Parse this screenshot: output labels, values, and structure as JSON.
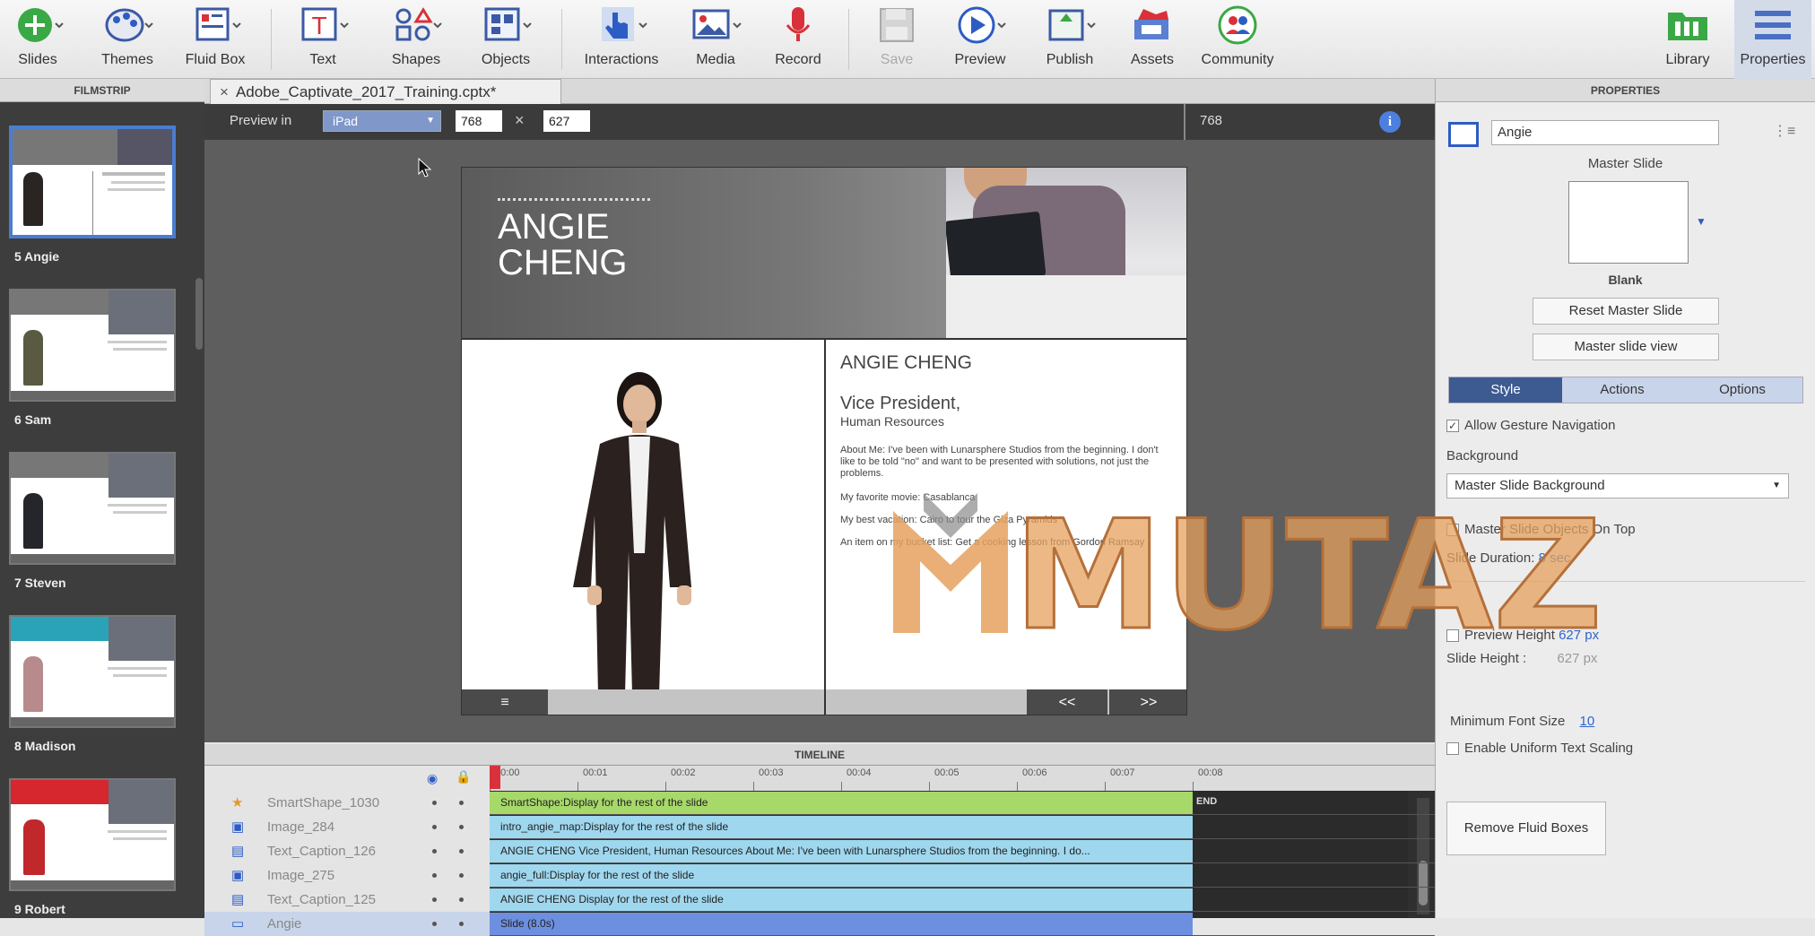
{
  "toolbar": {
    "items": [
      {
        "label": "Slides",
        "icon": "add-slide-icon"
      },
      {
        "label": "Themes",
        "icon": "palette-icon"
      },
      {
        "label": "Fluid Box",
        "icon": "fluid-box-icon"
      },
      {
        "label": "Text",
        "icon": "text-icon"
      },
      {
        "label": "Shapes",
        "icon": "shapes-icon"
      },
      {
        "label": "Objects",
        "icon": "objects-icon"
      },
      {
        "label": "Interactions",
        "icon": "hand-pointer-icon"
      },
      {
        "label": "Media",
        "icon": "image-icon"
      },
      {
        "label": "Record",
        "icon": "microphone-icon"
      },
      {
        "label": "Save",
        "icon": "save-icon"
      },
      {
        "label": "Preview",
        "icon": "play-icon"
      },
      {
        "label": "Publish",
        "icon": "publish-icon"
      },
      {
        "label": "Assets",
        "icon": "assets-icon"
      },
      {
        "label": "Community",
        "icon": "community-icon"
      },
      {
        "label": "Library",
        "icon": "library-icon"
      },
      {
        "label": "Properties",
        "icon": "properties-icon"
      }
    ]
  },
  "filmstrip": {
    "title": "FILMSTRIP",
    "slides": [
      {
        "label": "5 Angie",
        "accent": "#777777"
      },
      {
        "label": "6 Sam",
        "accent": "#777777"
      },
      {
        "label": "7 Steven",
        "accent": "#777777"
      },
      {
        "label": "8 Madison",
        "accent": "#2aa3b8"
      },
      {
        "label": "9 Robert",
        "accent": "#d6262e"
      }
    ]
  },
  "document": {
    "tab_close": "×",
    "tab_title": "Adobe_Captivate_2017_Training.cptx*"
  },
  "previewbar": {
    "label": "Preview in",
    "device": "iPad",
    "width": "768",
    "times": "×",
    "height": "627",
    "breakpoint": "768"
  },
  "slide": {
    "name_line1": "ANGIE",
    "name_line2": "CHENG",
    "heading": "ANGIE CHENG",
    "role": "Vice President,",
    "dept": "Human Resources",
    "about": "About Me: I've been with Lunarsphere Studios from the beginning. I don't like to be told \"no\" and want to be presented with solutions, not just the problems.",
    "movie": "My favorite movie: Casablanca",
    "vacation": "My best vacation: Cairo to tour the Giza Pyramids",
    "bucket": "An item on my bucket list: Get a cooking lesson from Gordon Ramsay",
    "nav_menu": "≡",
    "nav_prev": "<<",
    "nav_next": ">>"
  },
  "timeline": {
    "title": "TIMELINE",
    "ticks": [
      "00:00",
      "00:01",
      "00:02",
      "00:03",
      "00:04",
      "00:05",
      "00:06",
      "00:07",
      "00:08"
    ],
    "end_label": "END",
    "rows": [
      {
        "name": "SmartShape_1030",
        "bar": "SmartShape:Display for the rest of the slide",
        "color": "#a6d86a",
        "icon": "star-icon"
      },
      {
        "name": "Image_284",
        "bar": "intro_angie_map:Display for the rest of the slide",
        "color": "#9fd7ee",
        "icon": "image-icon"
      },
      {
        "name": "Text_Caption_126",
        "bar": "ANGIE CHENG  Vice President, Human Resources  About Me: I've been with Lunarsphere Studios from the beginning. I do...",
        "color": "#9fd7ee",
        "icon": "caption-icon"
      },
      {
        "name": "Image_275",
        "bar": "angie_full:Display for the rest of the slide",
        "color": "#9fd7ee",
        "icon": "image-icon"
      },
      {
        "name": "Text_Caption_125",
        "bar": "ANGIE  CHENG  Display for the rest of the slide",
        "color": "#9fd7ee",
        "icon": "caption-icon"
      },
      {
        "name": "Angie",
        "bar": "Slide (8.0s)",
        "color": "#6d8fe0",
        "icon": "slide-icon"
      }
    ]
  },
  "properties": {
    "title": "PROPERTIES",
    "slide_name": "Angie",
    "master_label": "Master Slide",
    "master_name": "Blank",
    "reset_btn": "Reset Master Slide",
    "view_btn": "Master slide view",
    "tabs": [
      "Style",
      "Actions",
      "Options"
    ],
    "allow_gesture": "Allow Gesture Navigation",
    "background_label": "Background",
    "background_value": "Master Slide Background",
    "master_on_top": "Master Slide Objects On Top",
    "duration_label": "Slide Duration:",
    "duration_value": "8 sec",
    "preview_height": "Preview Height",
    "preview_height_value": "627 px",
    "slide_height": "Slide Height :",
    "slide_height_value": "627 px",
    "min_font_label": "Minimum Font Size",
    "min_font_value": "10",
    "uniform_scaling": "Enable Uniform Text Scaling",
    "remove_btn": "Remove Fluid Boxes"
  },
  "watermark": {
    "text": "MUTAZ"
  }
}
